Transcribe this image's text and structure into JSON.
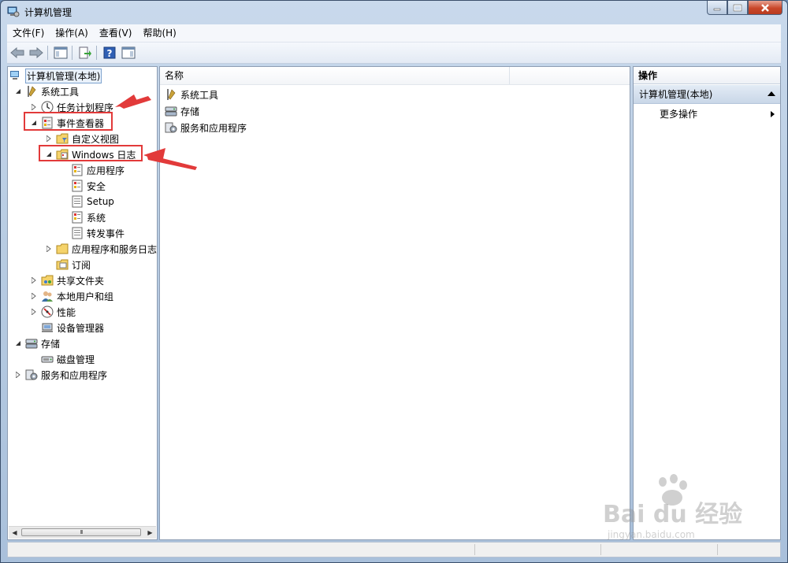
{
  "window": {
    "title": "计算机管理",
    "buttons": {
      "minimize": "minimize",
      "maximize": "maximize",
      "close": "close"
    }
  },
  "menubar": [
    {
      "label": "文件(F)"
    },
    {
      "label": "操作(A)"
    },
    {
      "label": "查看(V)"
    },
    {
      "label": "帮助(H)"
    }
  ],
  "toolbar": {
    "icons": [
      "back-arrow-icon",
      "forward-arrow-icon",
      "show-hide-tree-icon",
      "export-list-icon",
      "help-icon",
      "show-hide-action-pane-icon"
    ]
  },
  "tree": {
    "root": "计算机管理(本地)",
    "system_tools": "系统工具",
    "task_scheduler": "任务计划程序",
    "event_viewer": "事件查看器",
    "custom_views": "自定义视图",
    "windows_logs": "Windows 日志",
    "application": "应用程序",
    "security": "安全",
    "setup": "Setup",
    "system": "系统",
    "forwarded_events": "转发事件",
    "app_service_logs": "应用程序和服务日志",
    "subscriptions": "订阅",
    "shared_folders": "共享文件夹",
    "local_users": "本地用户和组",
    "performance": "性能",
    "device_manager": "设备管理器",
    "storage": "存储",
    "disk_management": "磁盘管理",
    "services_apps": "服务和应用程序",
    "scroll_thumb": "III"
  },
  "list": {
    "column_name": "名称",
    "rows": [
      "系统工具",
      "存储",
      "服务和应用程序"
    ]
  },
  "actions": {
    "header": "操作",
    "section": "计算机管理(本地)",
    "more": "更多操作"
  },
  "annotation": {
    "color": "#e23a3a"
  },
  "watermark": {
    "brand": "Bai du 经验",
    "url": "jingyan.baidu.com"
  }
}
